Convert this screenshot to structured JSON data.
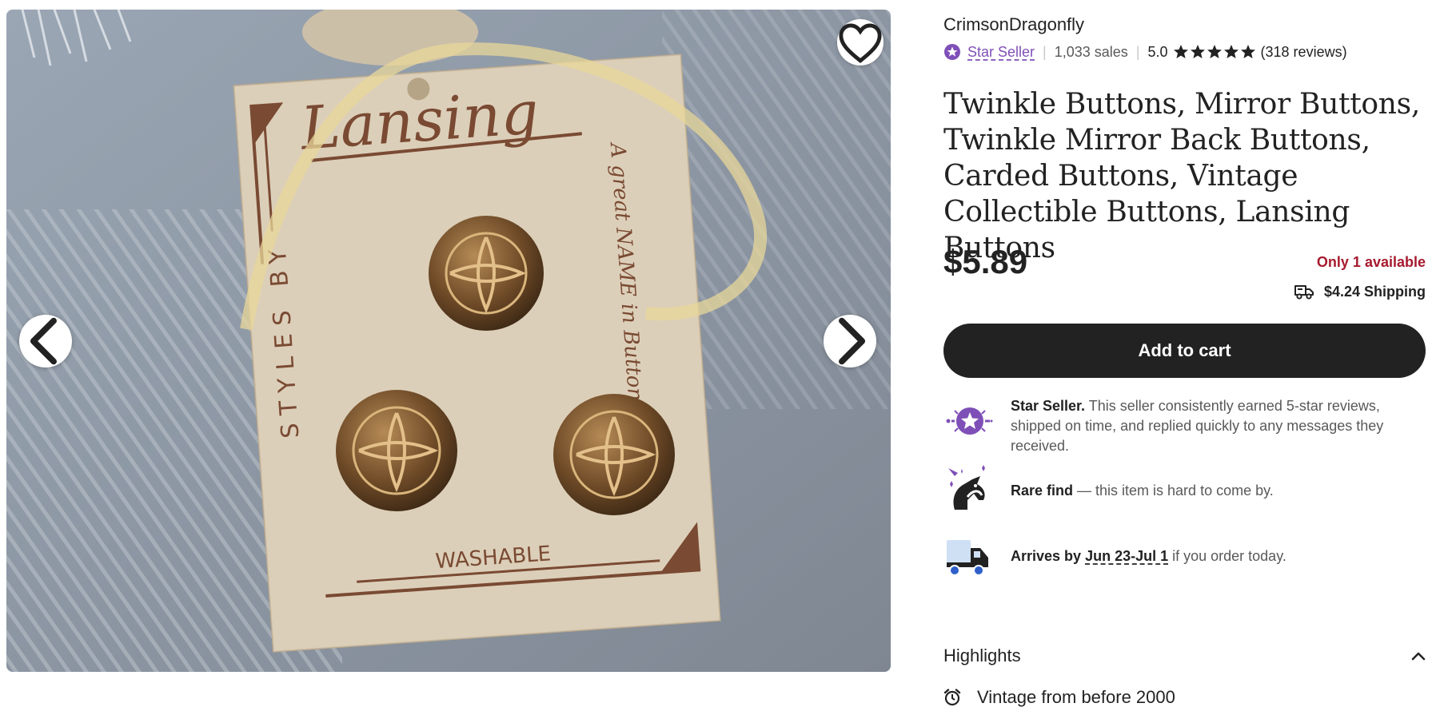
{
  "listing": {
    "shop_name": "CrimsonDragonfly",
    "star_seller_label": "Star Seller",
    "sales": "1,033 sales",
    "rating": "5.0",
    "rating_stars": 5,
    "reviews": "(318 reviews)",
    "title": "Twinkle Buttons, Mirror Buttons, Twinkle Mirror Back Buttons, Carded Buttons, Vintage Collectible Buttons, Lansing Buttons",
    "price": "$5.89",
    "stock": "Only 1 available",
    "shipping": "$4.24 Shipping",
    "add_to_cart": "Add to cart"
  },
  "features": {
    "star_seller": {
      "bold": "Star Seller.",
      "text": " This seller consistently earned 5-star reviews, shipped on time, and replied quickly to any messages they received."
    },
    "rare_find": {
      "bold": "Rare find",
      "text": " — this item is hard to come by."
    },
    "arrives": {
      "prefix": "Arrives by ",
      "date": "Jun 23-Jul 1",
      "suffix": " if you order today."
    }
  },
  "highlights": {
    "heading": "Highlights",
    "items": [
      "Vintage from before 2000"
    ]
  },
  "image_card": {
    "brand": "Lansing",
    "styles_by": "STYLES BY",
    "tagline": "A great NAME in Buttons",
    "washable": "WASHABLE"
  },
  "colors": {
    "accent_purple": "#7f4fb8",
    "stock_red": "#a61a2e",
    "button_dark": "#222222"
  },
  "icons": {
    "favorite": "heart-outline-icon",
    "prev": "chevron-left-icon",
    "next": "chevron-right-icon",
    "shipping": "truck-icon",
    "highlights_toggle": "chevron-up-icon",
    "vintage": "alarm-clock-icon"
  }
}
